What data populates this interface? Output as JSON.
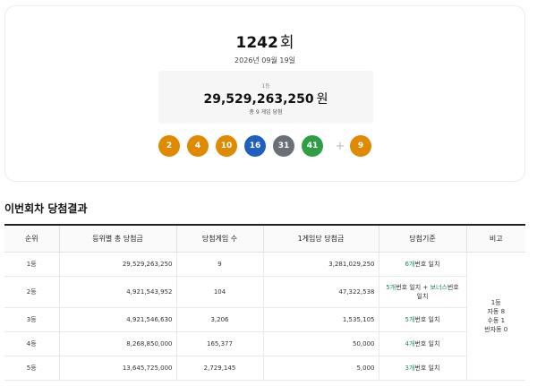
{
  "draw": {
    "round_number": "1242",
    "round_unit": "회",
    "date": "2026년 09월 19일",
    "first_prize_rank": "1등",
    "first_prize_amount": "29,529,263,250",
    "first_prize_unit": "원",
    "first_prize_games": "총 9 게임 당첨",
    "numbers": [
      {
        "value": "2",
        "color": "#e08a00"
      },
      {
        "value": "4",
        "color": "#e08a00"
      },
      {
        "value": "10",
        "color": "#e08a00"
      },
      {
        "value": "16",
        "color": "#1e5fc0"
      },
      {
        "value": "31",
        "color": "#6b6f78"
      },
      {
        "value": "41",
        "color": "#2f9e44"
      }
    ],
    "plus_symbol": "+",
    "bonus": {
      "value": "9",
      "color": "#e08a00"
    }
  },
  "results": {
    "title": "이번회차 당첨결과",
    "headers": [
      "순위",
      "등위별 총 당첨금",
      "당첨게임 수",
      "1게임당 당첨금",
      "당첨기준",
      "비고"
    ],
    "rows": [
      {
        "rank": "1등",
        "total": "29,529,263,250",
        "games": "9",
        "per_game": "3,281,029,250",
        "crit_a": "6개",
        "crit_b": "번호 일치"
      },
      {
        "rank": "2등",
        "total": "4,921,543,952",
        "games": "104",
        "per_game": "47,322,538",
        "crit_a": "5개",
        "crit_b": "번호 일치 + ",
        "crit_c": "보너스",
        "crit_d": "번호",
        "crit_e": "일치"
      },
      {
        "rank": "3등",
        "total": "4,921,546,630",
        "games": "3,206",
        "per_game": "1,535,105",
        "crit_a": "5개",
        "crit_b": "번호 일치"
      },
      {
        "rank": "4등",
        "total": "8,268,850,000",
        "games": "165,377",
        "per_game": "50,000",
        "crit_a": "4개",
        "crit_b": "번호 일치"
      },
      {
        "rank": "5등",
        "total": "13,645,725,000",
        "games": "2,729,145",
        "per_game": "5,000",
        "crit_a": "3개",
        "crit_b": "번호 일치"
      }
    ],
    "note": [
      "1등",
      "자동 8",
      "수동 1",
      "반자동 0"
    ]
  }
}
